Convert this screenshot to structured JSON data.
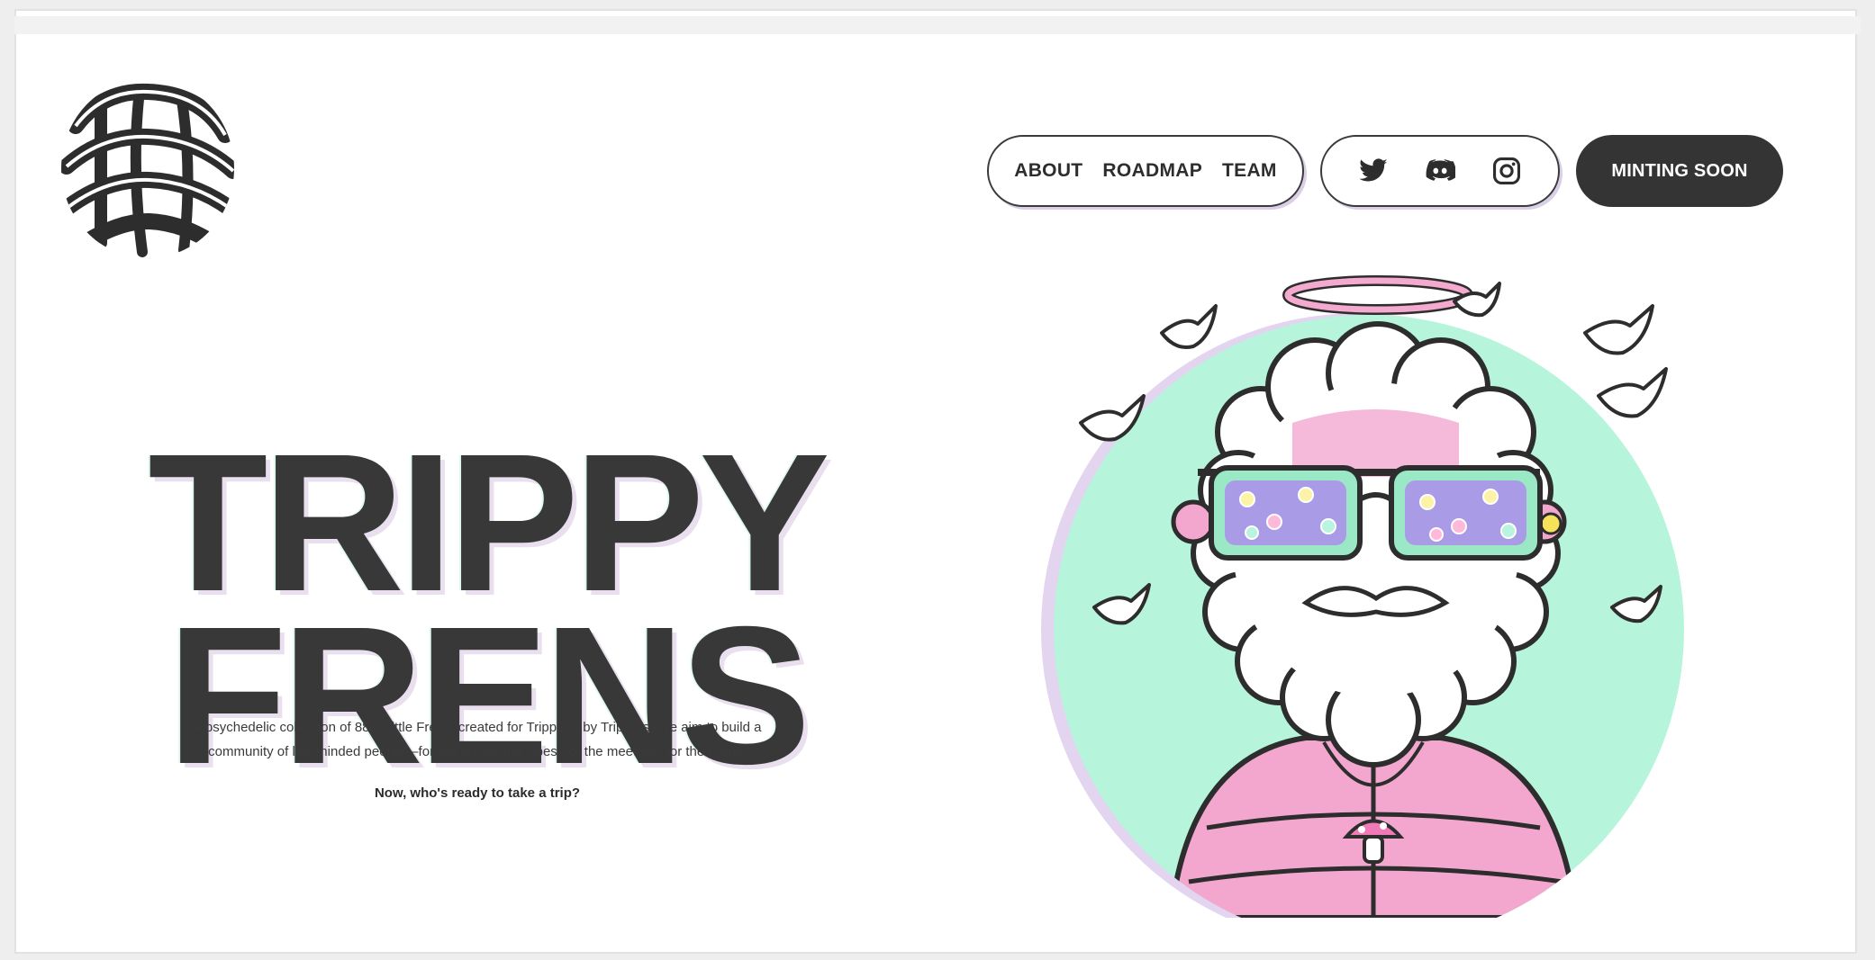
{
  "brand": {
    "logo_text": "TRIPPY FRENS"
  },
  "nav": {
    "about": "ABOUT",
    "roadmap": "ROADMAP",
    "team": "TEAM"
  },
  "social": {
    "icons": [
      "twitter-icon",
      "discord-icon",
      "instagram-icon"
    ]
  },
  "cta": {
    "mint_label": "MINTING SOON"
  },
  "hero": {
    "title_line1": "TRIPPY",
    "title_line2": "FRENS",
    "description": "A psychedelic collection of 8888 little Frens, created for Trippers, by Trippers. We aim to build a community of like minded people—for the art, for the vibes, for the meetups, for the Frens.",
    "call_to_action": "Now, who's ready to take a trip?"
  },
  "colors": {
    "text_dark": "#383838",
    "button_dark": "#343434",
    "mint_circle": "#b7f4dc",
    "halo_pink": "#f4a9cf",
    "lens_purple": "#a99be6",
    "jacket_pink": "#f3a7cf"
  }
}
